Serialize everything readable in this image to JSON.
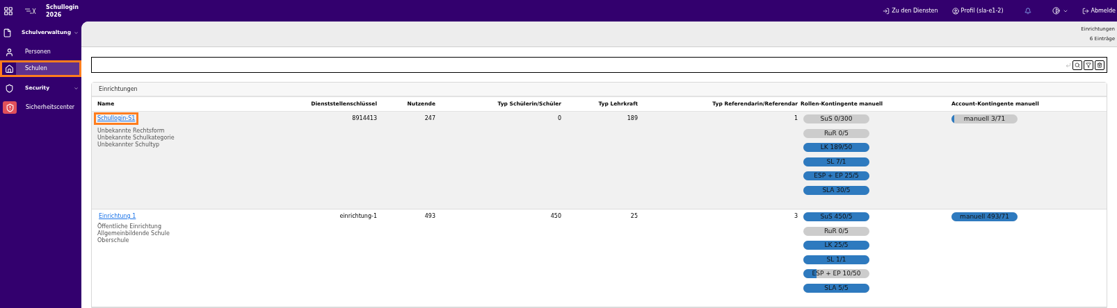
{
  "header": {
    "app_title": "Schullogin",
    "app_year": "2026",
    "links": [
      {
        "kind": "services",
        "label": "Zu den Diensten"
      },
      {
        "kind": "profile",
        "label": "Profil (sla-e1-2)"
      },
      {
        "kind": "bell"
      },
      {
        "kind": "theme"
      },
      {
        "kind": "logout",
        "label": "Abmelde"
      }
    ]
  },
  "sidebar": {
    "items": [
      {
        "kind": "section",
        "label": "Schulverwaltung",
        "expanded": true,
        "selected": false,
        "highlighted": false
      },
      {
        "kind": "item",
        "label": "Personen",
        "selected": false,
        "highlighted": false
      },
      {
        "kind": "item",
        "label": "Schulen",
        "selected": true,
        "highlighted": true
      },
      {
        "kind": "section",
        "label": "Security",
        "expanded": true,
        "selected": false,
        "highlighted": false
      },
      {
        "kind": "item",
        "label": "Sicherheitscenter",
        "selected": false,
        "highlighted": false
      }
    ]
  },
  "page": {
    "title": "Einrichtungen",
    "count": "6 Einträge"
  },
  "table": {
    "title": "Einrichtungen",
    "columns": [
      "Name",
      "Dienststellenschlüssel",
      "Nutzende",
      "Typ Schülerin/Schüler",
      "Typ Lehrkraft",
      "Typ Referendarin/Referendar",
      "Rollen-Kontingente manuell",
      "Account-Kontingente manuell"
    ],
    "rows": [
      {
        "selected": true,
        "highlighted": true,
        "name": "Schullogin-S1",
        "details": [
          "Unbekannte Rechtsform",
          "Unbekannte Schulkategorie",
          "Unbekannter Schultyp"
        ],
        "key": "8914413",
        "users": "247",
        "students": "0",
        "teachers": "189",
        "trainees": "1",
        "quotas": [
          {
            "label": "SuS 0/300",
            "level": 0
          },
          {
            "label": "RuR 0/5",
            "level": 0
          },
          {
            "label": "LK 189/50",
            "level": 1
          },
          {
            "label": "SL 7/1",
            "level": 1
          },
          {
            "label": "ESP + EP 25/5",
            "level": 1
          },
          {
            "label": "SLA 30/5",
            "level": 1
          }
        ],
        "accounts": [
          {
            "label": "manuell 3/71",
            "level": 0.04
          }
        ]
      },
      {
        "selected": false,
        "highlighted": false,
        "name": "Einrichtung 1",
        "details": [
          "Öffentliche Einrichtung",
          "Allgemeinbildende Schule",
          "Oberschule"
        ],
        "key": "einrichtung-1",
        "users": "493",
        "students": "450",
        "teachers": "25",
        "trainees": "3",
        "quotas": [
          {
            "label": "SuS 450/5",
            "level": 1
          },
          {
            "label": "RuR 0/5",
            "level": 0
          },
          {
            "label": "LK 25/5",
            "level": 1
          },
          {
            "label": "SL 1/1",
            "level": 1
          },
          {
            "label": "ESP + EP 10/50",
            "level": 0.2
          },
          {
            "label": "SLA 5/5",
            "level": 1
          }
        ],
        "accounts": [
          {
            "label": "manuell 493/71",
            "level": 1
          }
        ]
      }
    ]
  }
}
